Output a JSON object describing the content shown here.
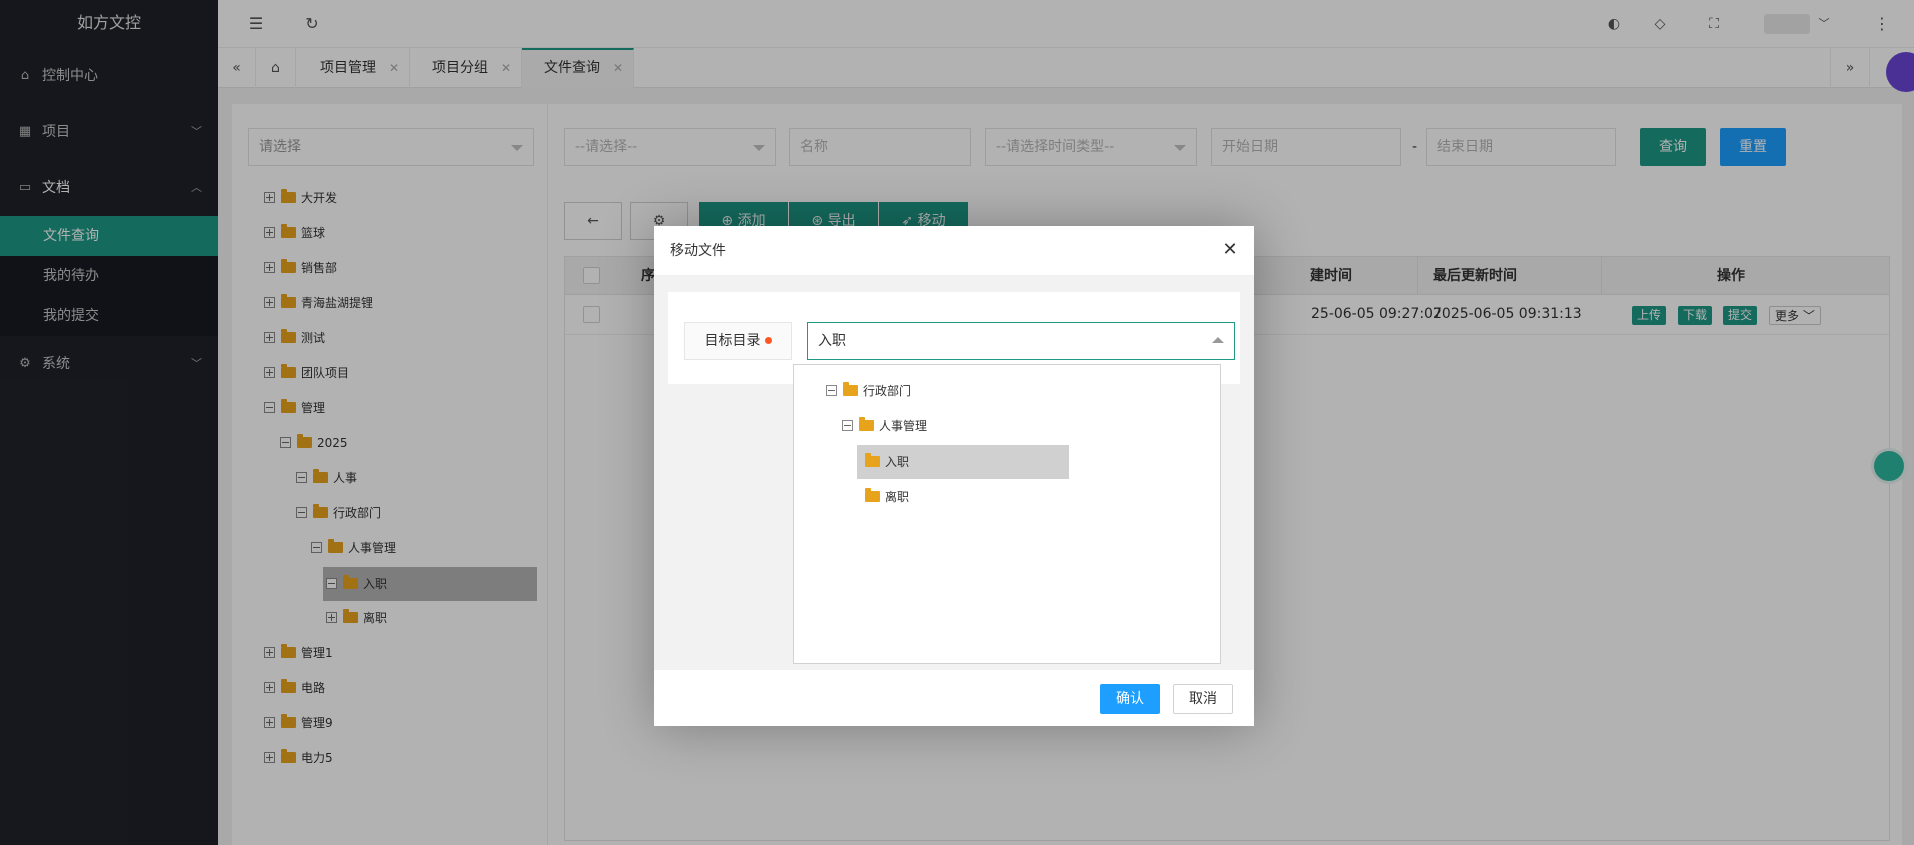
{
  "app": {
    "title": "如方文控"
  },
  "sidebar": {
    "items": [
      {
        "label": "控制中心",
        "icon": "home-icon"
      },
      {
        "label": "项目",
        "icon": "apps-icon"
      },
      {
        "label": "文档",
        "icon": "file-icon"
      },
      {
        "label": "系统",
        "icon": "gear-icon"
      }
    ],
    "sub_items": [
      {
        "label": "文件查询",
        "active": true
      },
      {
        "label": "我的待办"
      },
      {
        "label": "我的提交"
      }
    ]
  },
  "header": {
    "icons": [
      "menu-fold-icon",
      "refresh-icon",
      "theme-icon",
      "tag-icon",
      "fullscreen-icon",
      "user-avatar",
      "more-icon"
    ]
  },
  "tabs": [
    {
      "label": "项目管理"
    },
    {
      "label": "项目分组"
    },
    {
      "label": "文件查询",
      "active": true
    }
  ],
  "tree": {
    "select_placeholder": "请选择",
    "nodes": [
      {
        "label": "大开发"
      },
      {
        "label": "篮球"
      },
      {
        "label": "销售部"
      },
      {
        "label": "青海盐湖提锂"
      },
      {
        "label": "测试"
      },
      {
        "label": "团队项目"
      },
      {
        "label": "管理"
      },
      {
        "label": "2025"
      },
      {
        "label": "人事"
      },
      {
        "label": "行政部门"
      },
      {
        "label": "人事管理"
      },
      {
        "label": "入职",
        "selected": true
      },
      {
        "label": "离职"
      },
      {
        "label": "管理1"
      },
      {
        "label": "电路"
      },
      {
        "label": "管理9"
      },
      {
        "label": "电力5"
      }
    ]
  },
  "filters": {
    "select1_placeholder": "--请选择--",
    "name_placeholder": "名称",
    "time_type_placeholder": "--请选择时间类型--",
    "start_date_placeholder": "开始日期",
    "dash": "-",
    "end_date_placeholder": "结束日期",
    "query_label": "查询",
    "reset_label": "重置"
  },
  "toolbar": {
    "add_label": "添加",
    "export_label": "导出",
    "move_label": "移动"
  },
  "grid": {
    "headers": {
      "seq": "序",
      "created": "建时间",
      "updated": "最后更新时间",
      "ops": "操作"
    },
    "rows": [
      {
        "created": "25-06-05 09:27:07",
        "updated": "2025-06-05 09:31:13"
      }
    ],
    "row_actions": {
      "upload": "上传",
      "download": "下载",
      "submit": "提交",
      "more": "更多"
    }
  },
  "dialog": {
    "title": "移动文件",
    "field_label": "目标目录",
    "field_value": "入职",
    "dropdown": [
      {
        "label": "行政部门"
      },
      {
        "label": "人事管理"
      },
      {
        "label": "入职",
        "selected": true
      },
      {
        "label": "离职"
      }
    ],
    "confirm_label": "确认",
    "cancel_label": "取消"
  },
  "colors": {
    "primary": "#1e9986",
    "blue": "#1e9fff",
    "sidebar": "#20222a",
    "required": "#ff5722",
    "folder": "#e7a31c"
  }
}
